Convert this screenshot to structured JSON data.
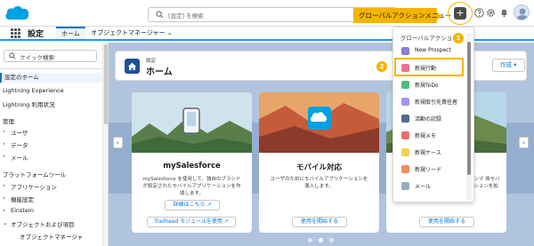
{
  "header": {
    "search_placeholder": "[設定] を検索",
    "global_actions_tip": "グローバルアクションメニュー",
    "plus_label": "+"
  },
  "appbar": {
    "app_name": "設定",
    "tabs": [
      {
        "label": "ホーム"
      },
      {
        "label": "オブジェクトマネージャー ⌄"
      }
    ]
  },
  "sidebar": {
    "quick_search_placeholder": "クイック検索",
    "items": [
      {
        "label": "設定のホーム"
      },
      {
        "label": "Lightning Experience"
      },
      {
        "label": "Lightning 利用状況"
      },
      {
        "label": "管理"
      },
      {
        "label": "ユーザ"
      },
      {
        "label": "データ"
      },
      {
        "label": "メール"
      },
      {
        "label": "プラットフォームツール"
      },
      {
        "label": "アプリケーション"
      },
      {
        "label": "機能設定"
      },
      {
        "label": "Einstein"
      },
      {
        "label": "オブジェクトおよび項目"
      },
      {
        "label": "オブジェクトマネージャ"
      }
    ]
  },
  "page_header": {
    "subtitle": "設定",
    "title": "ホーム",
    "create_button": "作成 ▾"
  },
  "cards": [
    {
      "title": "mySalesforce",
      "description": "mySalesforce を使用して、独自のブランドが設定されたモバイルアプリケーションを作成します。",
      "primary_button": "詳細はこちら ↗",
      "secondary_button": "Trailhead モジュールを使用 ↗"
    },
    {
      "title": "モバイル対応",
      "description": "ユーザのためにモバイルアプリケーションを導入します。",
      "secondary_button": "使用を開始する"
    },
    {
      "title": "クセス",
      "description": "アプリケーションマ 用モバイルアプリケーションを拡",
      "secondary_button": "使用を開始する"
    }
  ],
  "carousel": {
    "prev": "‹",
    "next": "›"
  },
  "global_actions": {
    "header": "グローバルアクション",
    "items": [
      {
        "label": "New Prospect",
        "color": "#8b7ed8"
      },
      {
        "label": "新規行動",
        "color": "#eb7092"
      },
      {
        "label": "新規ToDo",
        "color": "#4bc076"
      },
      {
        "label": "新規取引先責任者",
        "color": "#a094ed"
      },
      {
        "label": "活動の記録",
        "color": "#4f6a92"
      },
      {
        "label": "新規メモ",
        "color": "#e6716e"
      },
      {
        "label": "新規ケース",
        "color": "#f2cf5b"
      },
      {
        "label": "新規リード",
        "color": "#f88962"
      },
      {
        "label": "メール",
        "color": "#95aec5"
      }
    ]
  },
  "badges": {
    "one": "1",
    "two": "2"
  },
  "colors": {
    "brand_blue": "#0176d3",
    "callout_yellow": "#f4b400",
    "header_icon": "#1b5297"
  }
}
